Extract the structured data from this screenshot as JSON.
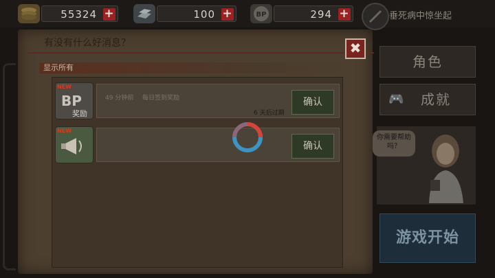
{
  "resources": [
    {
      "icon": "coin-stack-icon",
      "value": "55324"
    },
    {
      "icon": "silver-bars-icon",
      "value": "100"
    },
    {
      "icon": "bp-badge-icon",
      "value": "294"
    }
  ],
  "plus_label": "+",
  "status_text": "垂死病中惊坐起",
  "dialog": {
    "title": "有没有什么好消息？",
    "close_label": "✖",
    "filter_label": "显示所有",
    "messages": [
      {
        "icon": "bp-reward-icon",
        "icon_text": "BP",
        "icon_sub": "奖励",
        "new_tag": "NEW",
        "time": "49 分钟前",
        "text": "每日签到奖励",
        "expiry": "6  天后过期",
        "confirm_label": "确认"
      },
      {
        "icon": "megaphone-icon",
        "icon_text": "",
        "icon_sub": "",
        "new_tag": "NEW",
        "time": "",
        "text": "",
        "expiry": "",
        "confirm_label": "确认"
      }
    ]
  },
  "side_menu": {
    "role_label": "角色",
    "achievement_label": "成就",
    "help_bubble": "你需要帮助吗？",
    "start_label": "游戏开始"
  },
  "colors": {
    "accent_red": "#9b2222",
    "start_blue": "#1d2d3a"
  }
}
